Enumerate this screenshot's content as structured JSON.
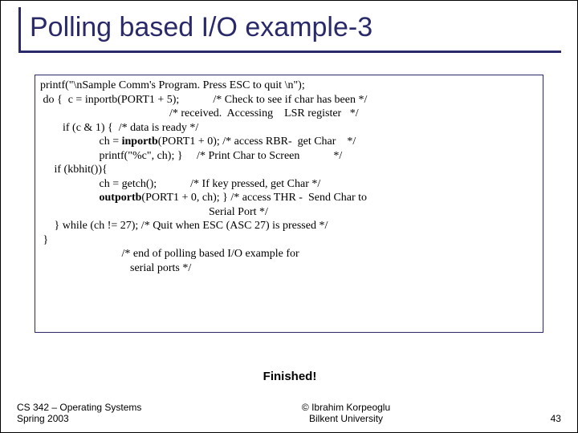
{
  "title": "Polling based I/O example-3",
  "code": {
    "l1": "printf(\"\\nSample Comm's Program. Press ESC to quit \\n\");",
    "l2": " do {  c = inportb(PORT1 + 5);            /* Check to see if char has been */",
    "l3": "                                              /* received.  Accessing    LSR register   */",
    "l4": "        if (c & 1) {  /* data is ready */",
    "l5a": "                     ch = ",
    "l5b": "inportb",
    "l5c": "(PORT1 + 0); /* access RBR-  get Char    */",
    "l6": "                     printf(\"%c\", ch); }     /* Print Char to Screen            */",
    "l7": "",
    "l8": "     if (kbhit()){",
    "l9": "                     ch = getch();            /* If key pressed, get Char */",
    "l10a": "                     ",
    "l10b": "outportb",
    "l10c": "(PORT1 + 0, ch); } /* access THR -  Send Char to",
    "l11": "                                                            Serial Port */",
    "l12": "     } while (ch != 27); /* Quit when ESC (ASC 27) is pressed */",
    "l13": " }",
    "l14": "",
    "l15": "                             /* end of polling based I/O example for",
    "l16": "                                serial ports */"
  },
  "finished": "Finished!",
  "footer": {
    "left1": "CS 342 – Operating Systems",
    "left2": "Spring 2003",
    "center1": "© Ibrahim Korpeoglu",
    "center2": "Bilkent University",
    "right": "43"
  }
}
